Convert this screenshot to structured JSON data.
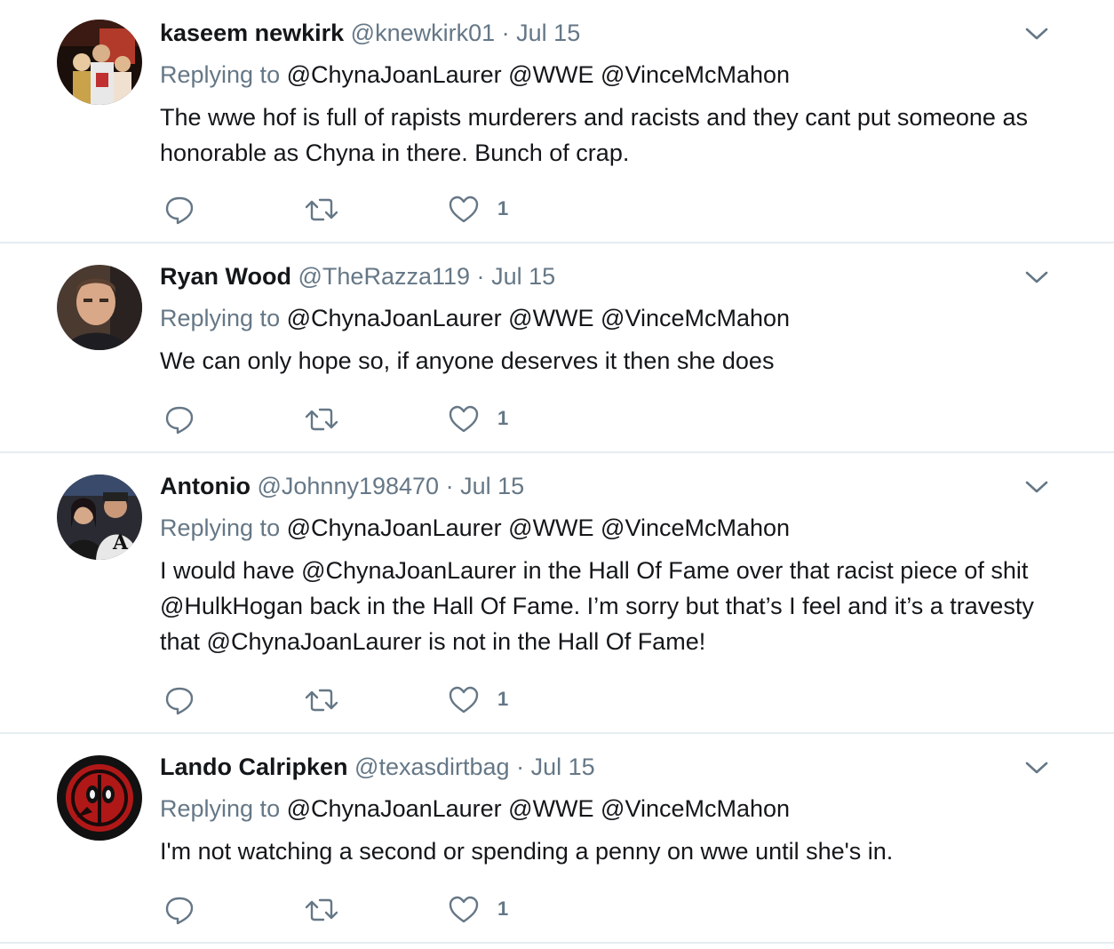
{
  "tweets": [
    {
      "name": "kaseem newkirk",
      "handle": "@knewkirk01",
      "sep": "·",
      "date": "Jul 15",
      "replying_prefix": "Replying to",
      "mentions": "@ChynaJoanLaurer @WWE @VinceMcMahon",
      "text": "The wwe hof is full of rapists murderers and racists and they cant put someone as honorable as Chyna in there. Bunch of crap.",
      "like_count": "1"
    },
    {
      "name": "Ryan Wood",
      "handle": "@TheRazza119",
      "sep": "·",
      "date": "Jul 15",
      "replying_prefix": "Replying to",
      "mentions": "@ChynaJoanLaurer @WWE @VinceMcMahon",
      "text": "We can only hope so, if anyone deserves it then she does",
      "like_count": "1"
    },
    {
      "name": "Antonio",
      "handle": "@Johnny198470",
      "sep": "·",
      "date": "Jul 15",
      "replying_prefix": "Replying to",
      "mentions": "@ChynaJoanLaurer @WWE @VinceMcMahon",
      "text": "I would have @ChynaJoanLaurer in the Hall Of Fame over that racist piece of shit @HulkHogan back in the Hall Of Fame. I’m sorry but that’s I feel and it’s a travesty that @ChynaJoanLaurer is not in the Hall Of Fame!",
      "like_count": "1"
    },
    {
      "name": "Lando Calripken",
      "handle": "@texasdirtbag",
      "sep": "·",
      "date": "Jul 15",
      "replying_prefix": "Replying to",
      "mentions": "@ChynaJoanLaurer @WWE @VinceMcMahon",
      "text": "I'm not watching a second or spending a penny on wwe until she's in.",
      "like_count": "1"
    }
  ],
  "icons": {
    "reply": "reply-icon",
    "retweet": "retweet-icon",
    "like": "heart-icon",
    "menu": "chevron-down-icon"
  },
  "colors": {
    "text": "#14171a",
    "secondary": "#657786",
    "divider": "#e6ecf0"
  }
}
